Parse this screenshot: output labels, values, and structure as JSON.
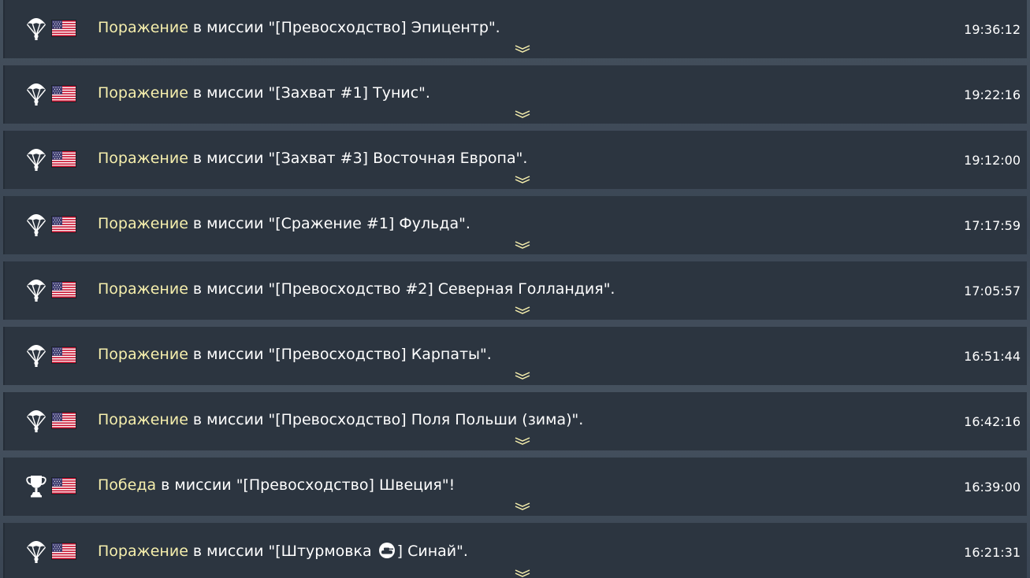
{
  "entries": [
    {
      "icon": "parachute-icon",
      "flag": "usa-flag-icon",
      "status": "Поражение",
      "text": " в миссии \"[Превосходство] Эпицентр\".",
      "time": "19:36:12"
    },
    {
      "icon": "parachute-icon",
      "flag": "usa-flag-icon",
      "status": "Поражение",
      "text": " в миссии \"[Захват #1] Тунис\".",
      "time": "19:22:16"
    },
    {
      "icon": "parachute-icon",
      "flag": "usa-flag-icon",
      "status": "Поражение",
      "text": " в миссии \"[Захват #3] Восточная Европа\".",
      "time": "19:12:00"
    },
    {
      "icon": "parachute-icon",
      "flag": "usa-flag-icon",
      "status": "Поражение",
      "text": " в миссии \"[Сражение #1] Фульда\".",
      "time": "17:17:59"
    },
    {
      "icon": "parachute-icon",
      "flag": "usa-flag-icon",
      "status": "Поражение",
      "text": " в миссии \"[Превосходство #2] Северная Голландия\".",
      "time": "17:05:57"
    },
    {
      "icon": "parachute-icon",
      "flag": "usa-flag-icon",
      "status": "Поражение",
      "text": " в миссии \"[Превосходство] Карпаты\".",
      "time": "16:51:44"
    },
    {
      "icon": "parachute-icon",
      "flag": "usa-flag-icon",
      "status": "Поражение",
      "text": " в миссии \"[Превосходство] Поля Польши (зима)\".",
      "time": "16:42:16"
    },
    {
      "icon": "trophy-icon",
      "flag": "usa-flag-icon",
      "status": "Победа",
      "text": " в миссии \"[Превосходство] Швеция\"!",
      "time": "16:39:00"
    },
    {
      "icon": "parachute-icon",
      "flag": "usa-flag-icon",
      "status": "Поражение",
      "text_before": " в миссии \"[Штурмовка ",
      "text_icon": "tank-icon",
      "text_after": "] Синай\".",
      "time": "16:21:31"
    }
  ],
  "colors": {
    "status_text": "#f6efad",
    "row_background": "#2c3540",
    "page_background": "#3a4553",
    "chevron": "#f6efad"
  }
}
